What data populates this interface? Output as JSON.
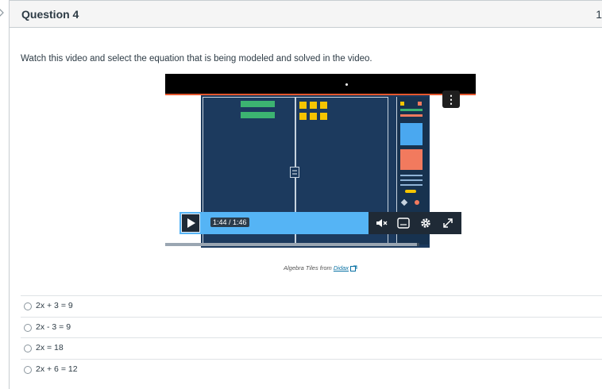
{
  "question": {
    "title": "Question 4",
    "points": "1"
  },
  "prompt": "Watch this video and select the equation that is being modeled and solved in the video.",
  "video": {
    "time": "1:44 / 1:46",
    "progress_fraction": 0.99,
    "menu_label": "⋮",
    "credit_prefix": "Algebra Tiles from ",
    "credit_link": "Didax"
  },
  "answers": [
    {
      "text": "2x + 3 = 9"
    },
    {
      "text": "2x - 3 = 9"
    },
    {
      "text": "2x = 18"
    },
    {
      "text": "2x + 6 = 12"
    }
  ],
  "colors": {
    "accent_blue": "#55b4f5",
    "tile_green": "#3cb371",
    "tile_yellow": "#f5c400",
    "board_navy": "#1c3a5e"
  }
}
